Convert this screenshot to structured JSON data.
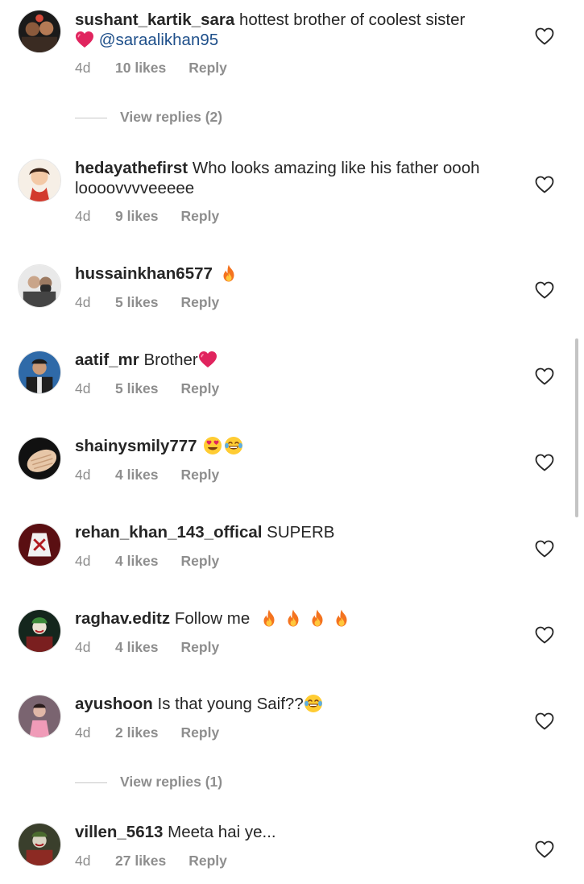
{
  "comments": [
    {
      "username": "sushant_kartik_sara",
      "text": "hottest brother of coolest sister",
      "mention": "@saraalikhan95",
      "age": "4d",
      "likes": "10 likes",
      "reply": "Reply"
    },
    {
      "username": "hedayathefirst",
      "text": "Who looks amazing like his father oooh loooovvvveeeee",
      "age": "4d",
      "likes": "9 likes",
      "reply": "Reply"
    },
    {
      "username": "hussainkhan6577",
      "text": "",
      "age": "4d",
      "likes": "5 likes",
      "reply": "Reply"
    },
    {
      "username": "aatif_mr",
      "text": "Brother",
      "age": "4d",
      "likes": "5 likes",
      "reply": "Reply"
    },
    {
      "username": "shainysmily777",
      "text": "",
      "age": "4d",
      "likes": "4 likes",
      "reply": "Reply"
    },
    {
      "username": "rehan_khan_143_offical",
      "text": "SUPERB",
      "age": "4d",
      "likes": "4 likes",
      "reply": "Reply"
    },
    {
      "username": "raghav.editz",
      "text": "Follow me",
      "age": "4d",
      "likes": "4 likes",
      "reply": "Reply"
    },
    {
      "username": "ayushoon",
      "text": "Is that young Saif??",
      "age": "4d",
      "likes": "2 likes",
      "reply": "Reply"
    },
    {
      "username": "villen_5613",
      "text": "Meeta hai ye...",
      "age": "4d",
      "likes": "27 likes",
      "reply": "Reply"
    }
  ],
  "view_replies": [
    "View replies (2)",
    "View replies (1)"
  ],
  "icons": {
    "like": "heart-outline-icon",
    "heart_emoji": "red-heart-emoji",
    "fire_emoji": "fire-emoji",
    "heart_eyes_emoji": "heart-eyes-emoji",
    "joy_emoji": "tears-of-joy-emoji"
  },
  "colors": {
    "text": "#262626",
    "meta": "#8e8e8e",
    "mention": "#1e4f8a",
    "background": "#ffffff"
  }
}
